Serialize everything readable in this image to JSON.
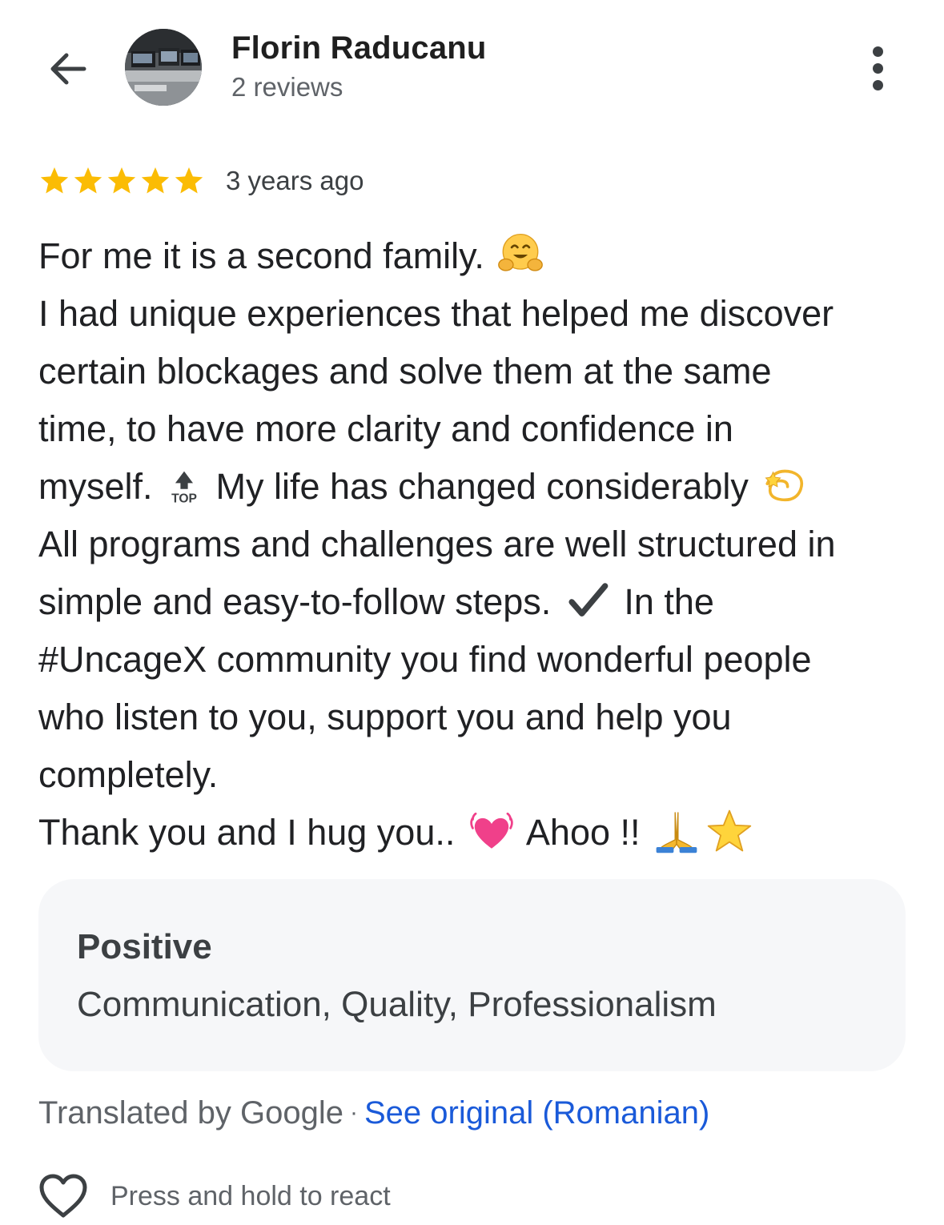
{
  "header": {
    "reviewer_name": "Florin Raducanu",
    "review_count": "2 reviews",
    "back_icon": "arrow-left-icon",
    "more_icon": "more-vertical-icon"
  },
  "review": {
    "rating": 5,
    "rating_max": 5,
    "time_ago": "3 years ago",
    "lines": [
      {
        "text": "For me it is a second family.",
        "after": "hugging-face-emoji"
      },
      {
        "text": "I had unique experiences that helped me discover"
      },
      {
        "text": "certain blockages and solve them at the same"
      },
      {
        "text": "time, to have more clarity and confidence in"
      },
      {
        "pre": "myself.",
        "mid": "My life has changed considerably"
      },
      {
        "text": "All programs and challenges are well structured in"
      },
      {
        "pre": "simple and easy-to-follow steps.",
        "mid": "In the"
      },
      {
        "text": "#UncageX community you find wonderful people"
      },
      {
        "text": "who listen to you, support you and help you"
      },
      {
        "text": "completely."
      },
      {
        "pre": "Thank you and I hug you..",
        "mid": "Ahoo !!"
      }
    ],
    "top_emoji_label": "TOP"
  },
  "positive": {
    "title": "Positive",
    "items": "Communication, Quality, Professionalism"
  },
  "translation": {
    "label": "Translated by Google",
    "separator": "·",
    "see_original": "See original (Romanian)"
  },
  "react": {
    "label": "Press and hold to react",
    "icon": "heart-outline-icon"
  },
  "colors": {
    "star": "#fbbc04",
    "link": "#1a5ad9",
    "box_bg": "#f6f7f9"
  }
}
